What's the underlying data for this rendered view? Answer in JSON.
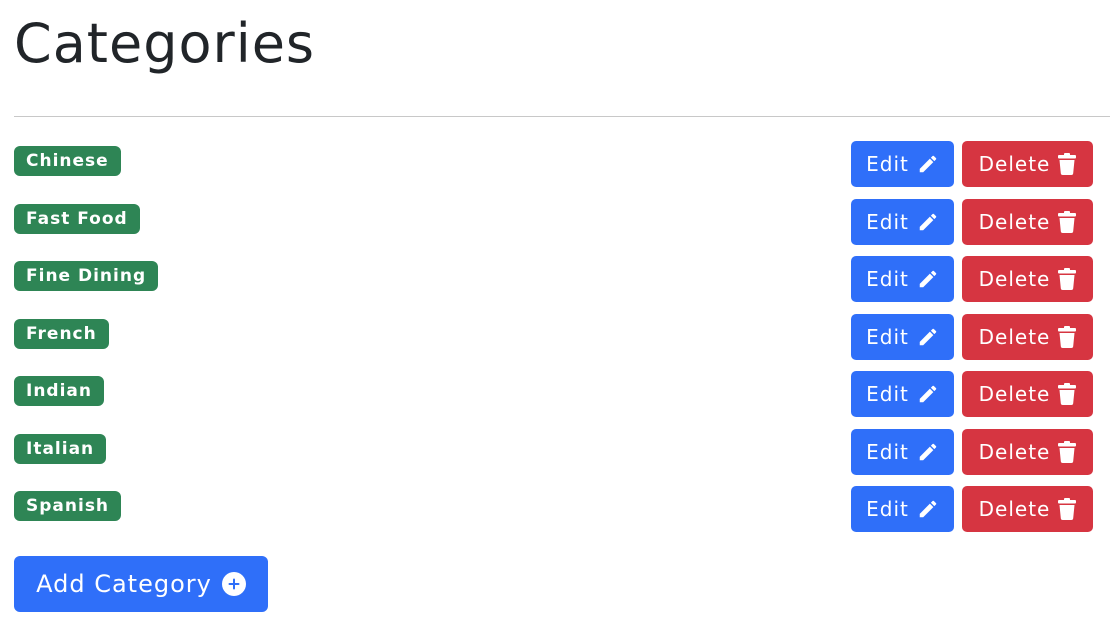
{
  "page": {
    "title": "Categories"
  },
  "categories": [
    {
      "name": "Chinese",
      "edit_label": "Edit",
      "delete_label": "Delete"
    },
    {
      "name": "Fast Food",
      "edit_label": "Edit",
      "delete_label": "Delete"
    },
    {
      "name": "Fine Dining",
      "edit_label": "Edit",
      "delete_label": "Delete"
    },
    {
      "name": "French",
      "edit_label": "Edit",
      "delete_label": "Delete"
    },
    {
      "name": "Indian",
      "edit_label": "Edit",
      "delete_label": "Delete"
    },
    {
      "name": "Italian",
      "edit_label": "Edit",
      "delete_label": "Delete"
    },
    {
      "name": "Spanish",
      "edit_label": "Edit",
      "delete_label": "Delete"
    }
  ],
  "actions": {
    "add_label": "Add Category"
  },
  "icons": {
    "edit": "pencil-icon",
    "delete": "trash-icon",
    "add": "plus-circle-icon"
  },
  "colors": {
    "badge": "#2e8555",
    "primary": "#2f6ff9",
    "danger": "#d63541",
    "title": "#212529"
  }
}
